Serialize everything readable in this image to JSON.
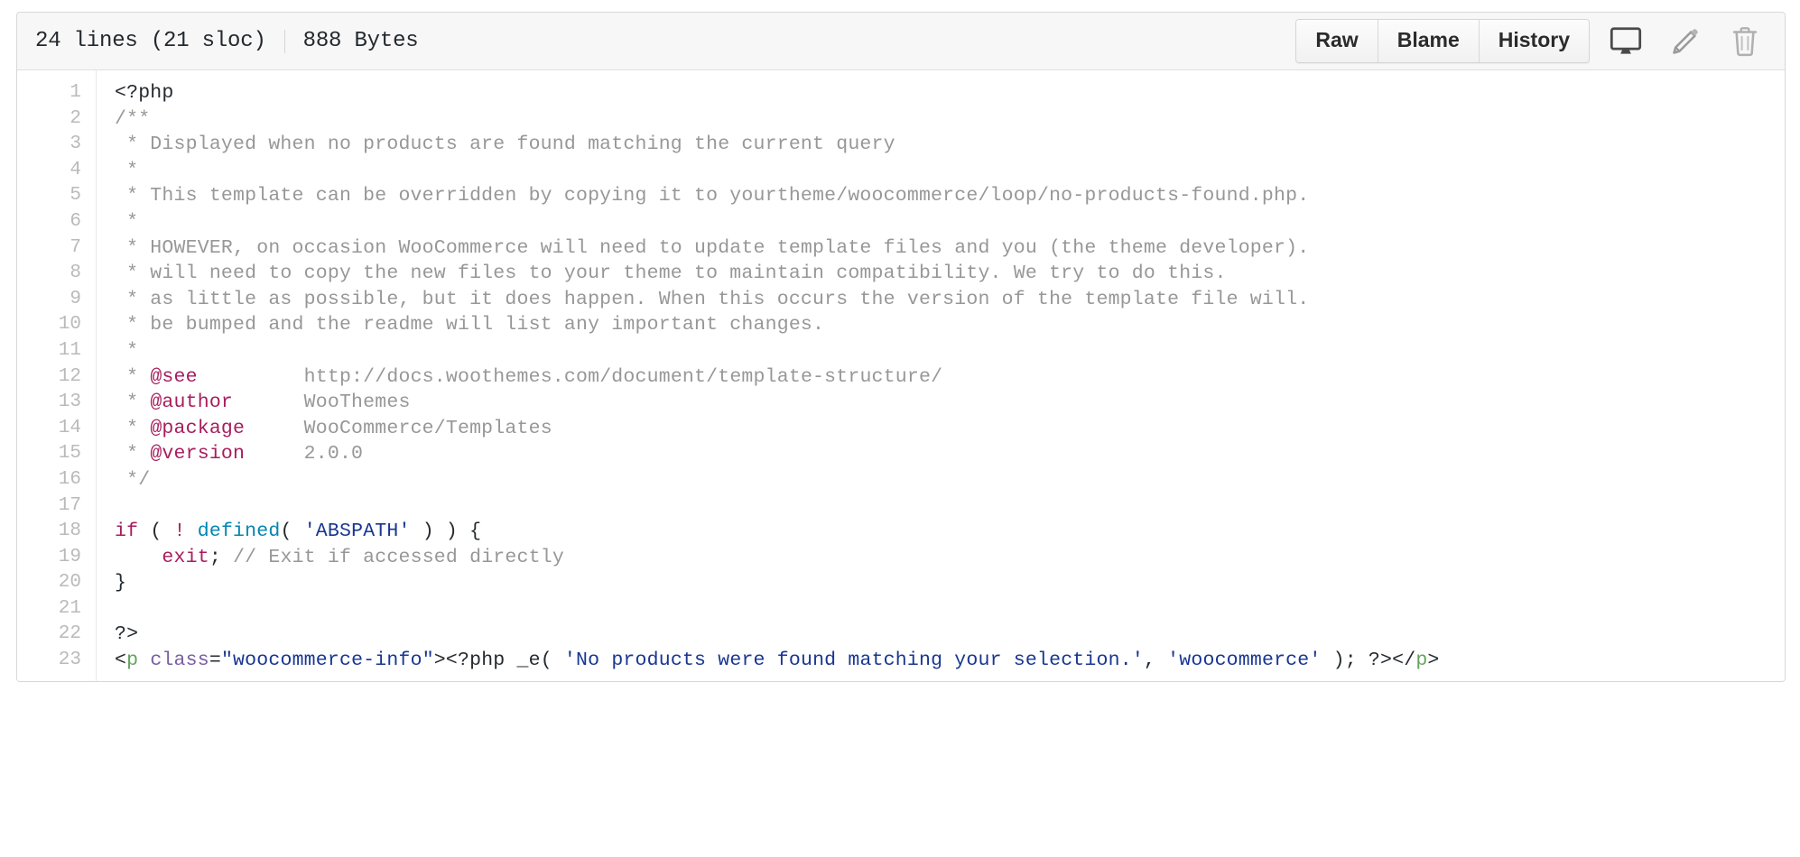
{
  "header": {
    "lines_text": "24 lines (21 sloc)",
    "size_text": "888 Bytes",
    "buttons": [
      {
        "label": "Raw",
        "name": "raw-button"
      },
      {
        "label": "Blame",
        "name": "blame-button"
      },
      {
        "label": "History",
        "name": "history-button"
      }
    ],
    "icons": [
      {
        "name": "desktop-icon",
        "title": "Open this file in GitHub Desktop"
      },
      {
        "name": "pencil-icon",
        "title": "Edit this file"
      },
      {
        "name": "trash-icon",
        "title": "Delete this file"
      }
    ]
  },
  "colors": {
    "comment": "#969896",
    "keyword": "#a71d5d",
    "function": "#0086b3",
    "string": "#183691",
    "html_tag": "#63a35c",
    "html_attr": "#795da3",
    "plain": "#24292e",
    "line_number": "#bababa",
    "header_bg": "#f7f7f7",
    "border": "#d8d8d8"
  },
  "code": {
    "language": "php",
    "total_lines": 23,
    "line_numbers": [
      1,
      2,
      3,
      4,
      5,
      6,
      7,
      8,
      9,
      10,
      11,
      12,
      13,
      14,
      15,
      16,
      17,
      18,
      19,
      20,
      21,
      22,
      23
    ],
    "lines": [
      {
        "n": 1,
        "tokens": [
          {
            "t": "<?php",
            "c": "pl"
          }
        ]
      },
      {
        "n": 2,
        "tokens": [
          {
            "t": "/**",
            "c": "c"
          }
        ]
      },
      {
        "n": 3,
        "tokens": [
          {
            "t": " * Displayed when no products are found matching the current query",
            "c": "c"
          }
        ]
      },
      {
        "n": 4,
        "tokens": [
          {
            "t": " *",
            "c": "c"
          }
        ]
      },
      {
        "n": 5,
        "tokens": [
          {
            "t": " * This template can be overridden by copying it to yourtheme/woocommerce/loop/no-products-found.php.",
            "c": "c"
          }
        ]
      },
      {
        "n": 6,
        "tokens": [
          {
            "t": " *",
            "c": "c"
          }
        ]
      },
      {
        "n": 7,
        "tokens": [
          {
            "t": " * HOWEVER, on occasion WooCommerce will need to update template files and you (the theme developer).",
            "c": "c"
          }
        ]
      },
      {
        "n": 8,
        "tokens": [
          {
            "t": " * will need to copy the new files to your theme to maintain compatibility. We try to do this.",
            "c": "c"
          }
        ]
      },
      {
        "n": 9,
        "tokens": [
          {
            "t": " * as little as possible, but it does happen. When this occurs the version of the template file will.",
            "c": "c"
          }
        ]
      },
      {
        "n": 10,
        "tokens": [
          {
            "t": " * be bumped and the readme will list any important changes.",
            "c": "c"
          }
        ]
      },
      {
        "n": 11,
        "tokens": [
          {
            "t": " *",
            "c": "c"
          }
        ]
      },
      {
        "n": 12,
        "tokens": [
          {
            "t": " * ",
            "c": "c"
          },
          {
            "t": "@see",
            "c": "tag"
          },
          {
            "t": "         http://docs.woothemes.com/document/template-structure/",
            "c": "c"
          }
        ]
      },
      {
        "n": 13,
        "tokens": [
          {
            "t": " * ",
            "c": "c"
          },
          {
            "t": "@author",
            "c": "tag"
          },
          {
            "t": "      WooThemes",
            "c": "c"
          }
        ]
      },
      {
        "n": 14,
        "tokens": [
          {
            "t": " * ",
            "c": "c"
          },
          {
            "t": "@package",
            "c": "tag"
          },
          {
            "t": "     WooCommerce/Templates",
            "c": "c"
          }
        ]
      },
      {
        "n": 15,
        "tokens": [
          {
            "t": " * ",
            "c": "c"
          },
          {
            "t": "@version",
            "c": "tag"
          },
          {
            "t": "     2.0.0",
            "c": "c"
          }
        ]
      },
      {
        "n": 16,
        "tokens": [
          {
            "t": " */",
            "c": "c"
          }
        ]
      },
      {
        "n": 17,
        "tokens": [
          {
            "t": "",
            "c": "pl"
          }
        ]
      },
      {
        "n": 18,
        "tokens": [
          {
            "t": "if",
            "c": "k"
          },
          {
            "t": " ( ",
            "c": "pl"
          },
          {
            "t": "!",
            "c": "k"
          },
          {
            "t": " ",
            "c": "pl"
          },
          {
            "t": "defined",
            "c": "fn"
          },
          {
            "t": "( ",
            "c": "pl"
          },
          {
            "t": "'ABSPATH'",
            "c": "s"
          },
          {
            "t": " ) ) {",
            "c": "pl"
          }
        ]
      },
      {
        "n": 19,
        "tokens": [
          {
            "t": "    ",
            "c": "pl"
          },
          {
            "t": "exit",
            "c": "k"
          },
          {
            "t": "; ",
            "c": "pl"
          },
          {
            "t": "// Exit if accessed directly",
            "c": "c"
          }
        ]
      },
      {
        "n": 20,
        "tokens": [
          {
            "t": "}",
            "c": "pl"
          }
        ]
      },
      {
        "n": 21,
        "tokens": [
          {
            "t": "",
            "c": "pl"
          }
        ]
      },
      {
        "n": 22,
        "tokens": [
          {
            "t": "?>",
            "c": "pl"
          }
        ]
      },
      {
        "n": 23,
        "tokens": [
          {
            "t": "<",
            "c": "pl"
          },
          {
            "t": "p",
            "c": "nt"
          },
          {
            "t": " ",
            "c": "pl"
          },
          {
            "t": "class",
            "c": "na"
          },
          {
            "t": "=",
            "c": "pl"
          },
          {
            "t": "\"woocommerce-info\"",
            "c": "s"
          },
          {
            "t": "><?php _e( ",
            "c": "pl"
          },
          {
            "t": "'No products were found matching your selection.'",
            "c": "s"
          },
          {
            "t": ", ",
            "c": "pl"
          },
          {
            "t": "'woocommerce'",
            "c": "s"
          },
          {
            "t": " ); ?></",
            "c": "pl"
          },
          {
            "t": "p",
            "c": "nt"
          },
          {
            "t": ">",
            "c": "pl"
          }
        ]
      }
    ]
  }
}
